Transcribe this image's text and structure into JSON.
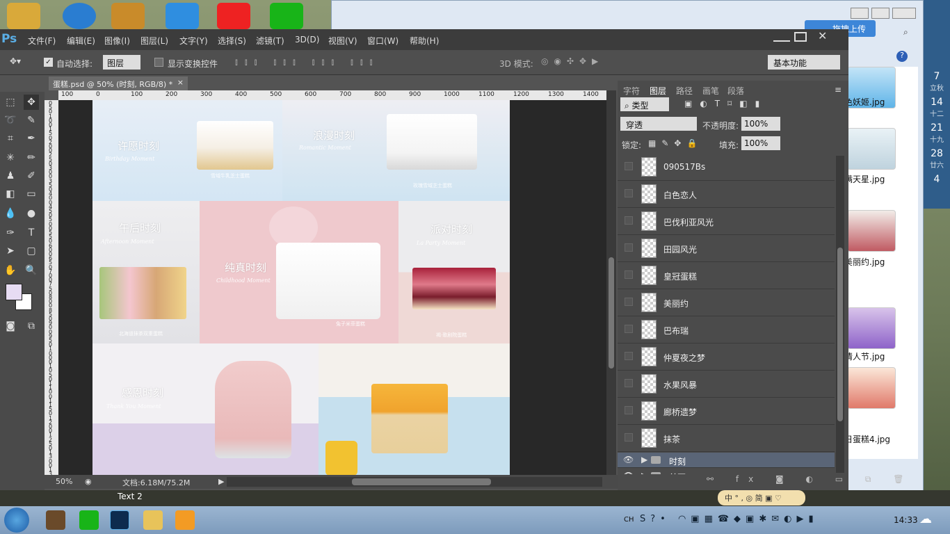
{
  "explorer": {
    "upload_label": "拖拽上传",
    "files": [
      "色妖姬.jpg",
      "满天星.jpg",
      "美丽约.jpg",
      "情人节.jpg",
      "日蛋糕4.jpg"
    ]
  },
  "calendar": [
    {
      "num": "7",
      "sub": "立秋"
    },
    {
      "num": "14",
      "sub": "十二"
    },
    {
      "num": "21",
      "sub": "十九"
    },
    {
      "num": "28",
      "sub": "廿六"
    },
    {
      "num": "4",
      "sub": ""
    }
  ],
  "ps": {
    "logo": "Ps",
    "menu": [
      "文件(F)",
      "编辑(E)",
      "图像(I)",
      "图层(L)",
      "文字(Y)",
      "选择(S)",
      "滤镜(T)",
      "3D(D)",
      "视图(V)",
      "窗口(W)",
      "帮助(H)"
    ],
    "options": {
      "auto_select_label": "自动选择:",
      "auto_select_value": "图层",
      "show_transform_label": "显示变换控件",
      "mode_3d_label": "3D 模式:",
      "workspace": "基本功能"
    },
    "doc_tab": "蛋糕.psd @ 50% (时刻, RGB/8) *",
    "ruler_top": [
      "100",
      "0",
      "100",
      "200",
      "300",
      "400",
      "500",
      "600",
      "700",
      "800",
      "900",
      "1000",
      "1100",
      "1200",
      "1300",
      "1400"
    ],
    "ruler_left": [
      "0",
      "5",
      "0",
      "1",
      "0",
      "0",
      "1",
      "5",
      "0",
      "2",
      "0",
      "0",
      "2",
      "5",
      "0",
      "3",
      "0",
      "0",
      "3",
      "5",
      "0",
      "4",
      "0",
      "0",
      "4",
      "5",
      "0",
      "5",
      "0",
      "0",
      "5",
      "5",
      "0",
      "6",
      "0",
      "0",
      "6",
      "5",
      "0",
      "7",
      "0",
      "0",
      "7",
      "5",
      "0",
      "8",
      "0",
      "0",
      "8",
      "5",
      "0",
      "9",
      "0",
      "0",
      "9",
      "5",
      "0",
      "1",
      "0",
      "0",
      "0",
      "1",
      "0",
      "5",
      "0",
      "1",
      "1",
      "0",
      "0",
      "1",
      "1",
      "5",
      "0",
      "1",
      "2",
      "0",
      "0",
      "1",
      "2",
      "5",
      "0",
      "1",
      "3",
      "0",
      "0",
      "1",
      "3",
      "5",
      "0"
    ],
    "zoom": "50%",
    "doc_size": "文档:6.18M/75.2M",
    "canvas": {
      "cells": [
        {
          "title": "许愿时刻",
          "sub": "Birthday Moment",
          "caption": "雪域牛乳芝士蛋糕"
        },
        {
          "title": "浪漫时刻",
          "sub": "Romantic Moment",
          "caption": "玫瑰雪域芝士蛋糕"
        },
        {
          "title": "午后时刻",
          "sub": "Afternoon Moment",
          "caption": "北海道抹茶双重蛋糕"
        },
        {
          "title": "纯真时刻",
          "sub": "Childhood Moment",
          "caption": "兔子米菲蛋糕"
        },
        {
          "title": "派对时刻",
          "sub": "La Party Moment",
          "caption": "褐·歌剧院蛋糕"
        },
        {
          "title": "感恩时刻",
          "sub": "Thank You Moment",
          "caption": ""
        },
        {
          "title": "",
          "sub": "",
          "caption": ""
        }
      ]
    },
    "panel": {
      "tabs": [
        "字符",
        "图层",
        "路径",
        "画笔",
        "段落"
      ],
      "filter_label": "类型",
      "blend_mode": "穿透",
      "opacity_label": "不透明度:",
      "opacity_value": "100%",
      "lock_label": "锁定:",
      "fill_label": "填充:",
      "fill_value": "100%",
      "layers": [
        "090517Bs",
        "白色恋人",
        "巴伐利亚风光",
        "田园风光",
        "皇冠蛋糕",
        "美丽约",
        "巴布瑞",
        "仲夏夜之梦",
        "水果风暴",
        "廊桥遗梦",
        "抹茶"
      ],
      "groups": [
        "时刻",
        "首页"
      ]
    }
  },
  "desktop_text": "Text 2",
  "taskbar": {
    "tray_lang": "CH",
    "clock": "14:33"
  }
}
